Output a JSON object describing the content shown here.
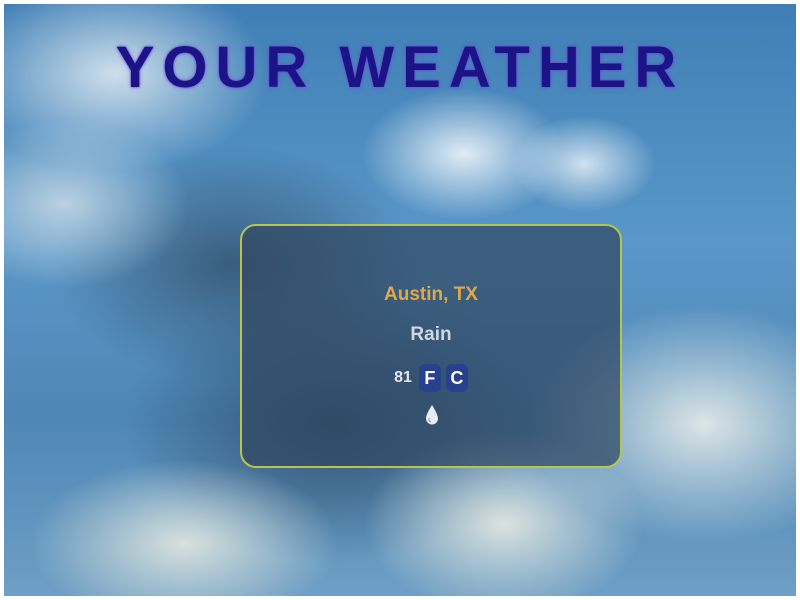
{
  "header": {
    "title": "YOUR WEATHER"
  },
  "weather": {
    "city": "Austin, TX",
    "condition": "Rain",
    "temperature": "81",
    "units": {
      "fahrenheit": "F",
      "celsius": "C"
    },
    "condition_icon": "raindrop-icon"
  },
  "colors": {
    "title": "#1a1486",
    "city": "#e0a84a",
    "card_border": "#b5c64a",
    "unit_button": "#27418e"
  }
}
